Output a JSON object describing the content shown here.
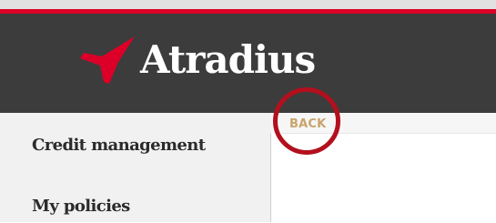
{
  "brand": {
    "name": "Atradius",
    "logo_icon": "atradius-star-icon",
    "accent_color": "#dc0028",
    "header_color": "#3c3c3c"
  },
  "nav": {
    "back_label": "BACK",
    "back_color": "#c9a46b"
  },
  "sidebar": {
    "items": [
      {
        "label": "Credit management"
      },
      {
        "label": "My policies"
      }
    ]
  },
  "annotation": {
    "highlight_color": "#b30f1d"
  }
}
